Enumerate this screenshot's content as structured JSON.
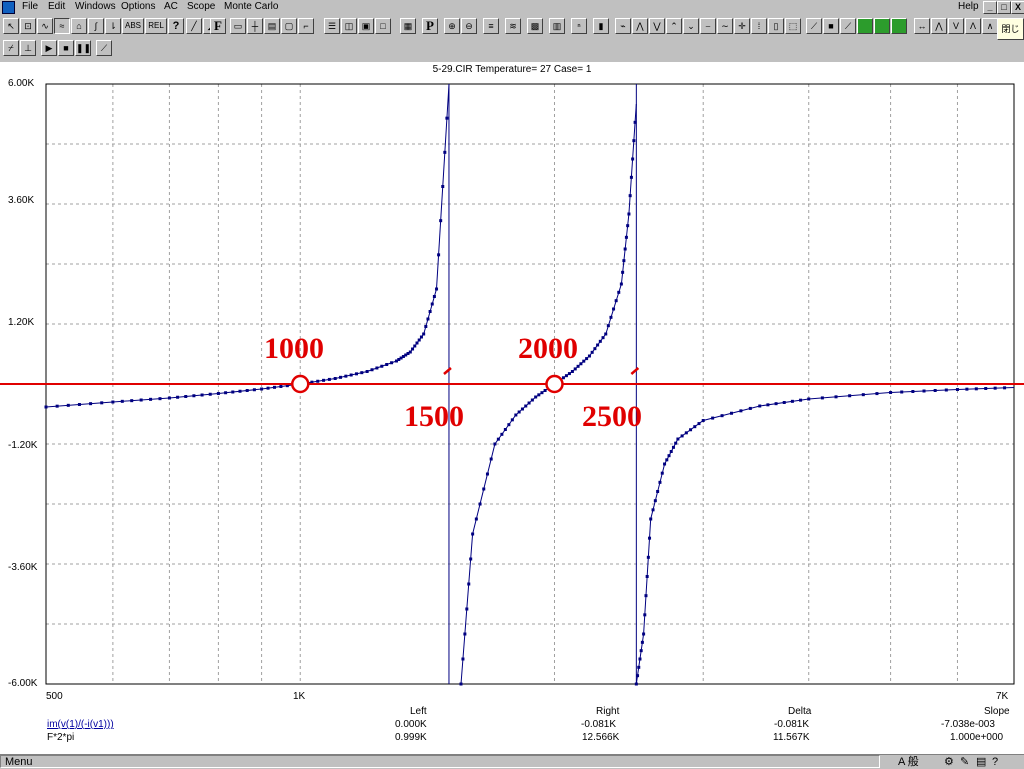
{
  "menubar": {
    "items": [
      "File",
      "Edit",
      "Windows",
      "Options",
      "AC",
      "Scope",
      "Monte Carlo"
    ],
    "help": "Help",
    "window_buttons": [
      "_",
      "□",
      "X"
    ]
  },
  "toolbar": {
    "abs_label": "ABS",
    "rel_label": "REL",
    "help_label": "?",
    "f_label": "F",
    "p_label": "P",
    "close_label": "閉じる"
  },
  "plot": {
    "title": "5-29.CIR Temperature= 27 Case= 1",
    "y_ticks": [
      "6.00K",
      "3.60K",
      "1.20K",
      "-1.20K",
      "-3.60K",
      "-6.00K"
    ],
    "x_ticks": [
      "500",
      "1K",
      "7K"
    ],
    "annotations": [
      "1000",
      "1500",
      "2000",
      "2500"
    ]
  },
  "info_panel": {
    "headers": [
      "Left",
      "Right",
      "Delta",
      "Slope"
    ],
    "rows": [
      {
        "expr": "im(v(1)/(-i(v1)))",
        "values": [
          "0.000K",
          "-0.081K",
          "-0.081K",
          "-7.038e-003"
        ]
      },
      {
        "expr": "F*2*pi",
        "values": [
          "0.999K",
          "12.566K",
          "11.567K",
          "1.000e+000"
        ]
      }
    ]
  },
  "status": {
    "text": "Menu",
    "tray": "A 般"
  },
  "chart_data": {
    "type": "line",
    "title": "5-29.CIR Temperature= 27 Case= 1",
    "xlabel": "",
    "ylabel": "",
    "xscale": "log",
    "xlim": [
      500,
      7000
    ],
    "ylim": [
      -6000,
      6000
    ],
    "series": [
      {
        "name": "im(v(1)/(-i(v1)))",
        "color": "#000080",
        "points": [
          [
            500,
            -460
          ],
          [
            600,
            -360
          ],
          [
            700,
            -280
          ],
          [
            800,
            -190
          ],
          [
            900,
            -100
          ],
          [
            1000,
            0
          ],
          [
            1100,
            110
          ],
          [
            1200,
            250
          ],
          [
            1300,
            460
          ],
          [
            1350,
            640
          ],
          [
            1400,
            1000
          ],
          [
            1450,
            1900
          ],
          [
            1500,
            6000
          ],
          [
            1550,
            -6000
          ],
          [
            1600,
            -3000
          ],
          [
            1700,
            -1200
          ],
          [
            1800,
            -620
          ],
          [
            1900,
            -260
          ],
          [
            2000,
            0
          ],
          [
            2100,
            250
          ],
          [
            2200,
            560
          ],
          [
            2300,
            1000
          ],
          [
            2400,
            2000
          ],
          [
            2450,
            3400
          ],
          [
            2500,
            5600
          ],
          [
            2500,
            -6000
          ],
          [
            2550,
            -5000
          ],
          [
            2600,
            -2700
          ],
          [
            2700,
            -1600
          ],
          [
            2800,
            -1100
          ],
          [
            3000,
            -730
          ],
          [
            3500,
            -440
          ],
          [
            4000,
            -300
          ],
          [
            5000,
            -170
          ],
          [
            6000,
            -110
          ],
          [
            7000,
            -70
          ]
        ]
      },
      {
        "name": "F*2*pi",
        "color": "#e00000",
        "points": [
          [
            500,
            0
          ],
          [
            7000,
            0
          ]
        ]
      }
    ],
    "markers": [
      [
        1000,
        0
      ],
      [
        2000,
        0
      ]
    ],
    "grid": true
  }
}
